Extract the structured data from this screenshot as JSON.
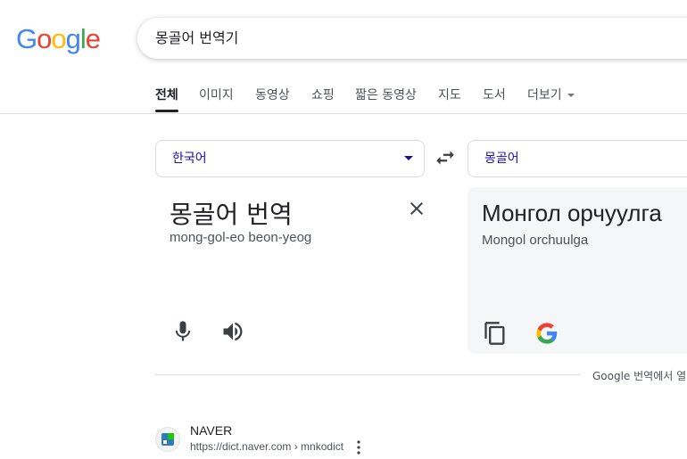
{
  "logo": {
    "letters": [
      "G",
      "o",
      "o",
      "g",
      "l",
      "e"
    ],
    "colors": [
      "#4285F4",
      "#EA4335",
      "#FBBC05",
      "#4285F4",
      "#34A853",
      "#EA4335"
    ]
  },
  "search": {
    "value": "몽골어 번역기"
  },
  "tabs": [
    {
      "label": "전체"
    },
    {
      "label": "이미지"
    },
    {
      "label": "동영상"
    },
    {
      "label": "쇼핑"
    },
    {
      "label": "짧은 동영상"
    },
    {
      "label": "지도"
    },
    {
      "label": "도서"
    },
    {
      "label": "더보기"
    }
  ],
  "translator": {
    "source_lang": "한국어",
    "target_lang": "몽골어",
    "source_text": "몽골어 번역",
    "source_romanization": "mong-gol-eo beon-yeog",
    "target_text": "Монгол орчуулга",
    "target_romanization": "Mongol orchuulga",
    "open_in_translate": "Google 번역에서 열기"
  },
  "result": {
    "site_name": "NAVER",
    "url": "https://dict.naver.com › mnkodict"
  },
  "colors": {
    "link_blue": "#1a0dab",
    "panel_bg": "#f5f6f8"
  }
}
